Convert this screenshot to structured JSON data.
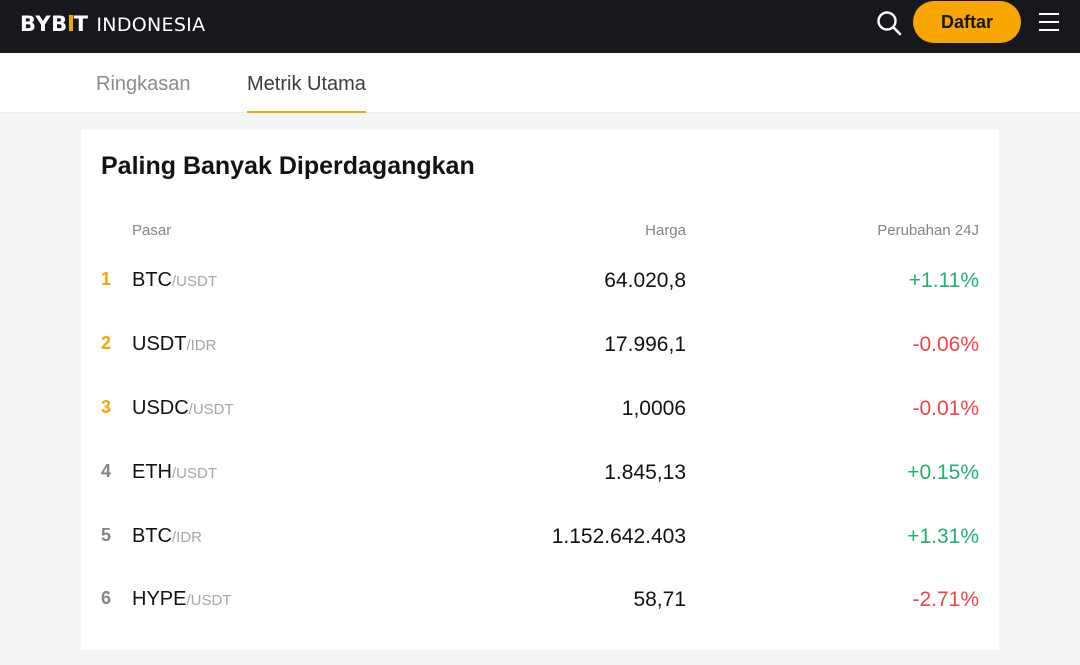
{
  "header": {
    "brand": "BYB",
    "brand_end": "T",
    "region": "INDONESIA",
    "signup_label": "Daftar"
  },
  "tabs": [
    {
      "label": "Ringkasan",
      "active": false
    },
    {
      "label": "Metrik Utama",
      "active": true
    }
  ],
  "section": {
    "title": "Paling Banyak Diperdagangkan",
    "columns": {
      "market": "Pasar",
      "price": "Harga",
      "change": "Perubahan 24J"
    },
    "rows": [
      {
        "rank": "1",
        "base": "BTC",
        "quote": "/USDT",
        "price": "64.020,8",
        "change": "+1.11%"
      },
      {
        "rank": "2",
        "base": "USDT",
        "quote": "/IDR",
        "price": "17.996,1",
        "change": "-0.06%"
      },
      {
        "rank": "3",
        "base": "USDC",
        "quote": "/USDT",
        "price": "1,0006",
        "change": "-0.01%"
      },
      {
        "rank": "4",
        "base": "ETH",
        "quote": "/USDT",
        "price": "1.845,13",
        "change": "+0.15%"
      },
      {
        "rank": "5",
        "base": "BTC",
        "quote": "/IDR",
        "price": "1.152.642.403",
        "change": "+1.31%"
      },
      {
        "rank": "6",
        "base": "HYPE",
        "quote": "/USDT",
        "price": "58,71",
        "change": "-2.71%"
      }
    ]
  },
  "colors": {
    "accent": "#f7a600",
    "positive": "#20b26c",
    "negative": "#ef454a",
    "topbar": "#17181e"
  },
  "icons": [
    "search-icon",
    "menu-icon"
  ]
}
